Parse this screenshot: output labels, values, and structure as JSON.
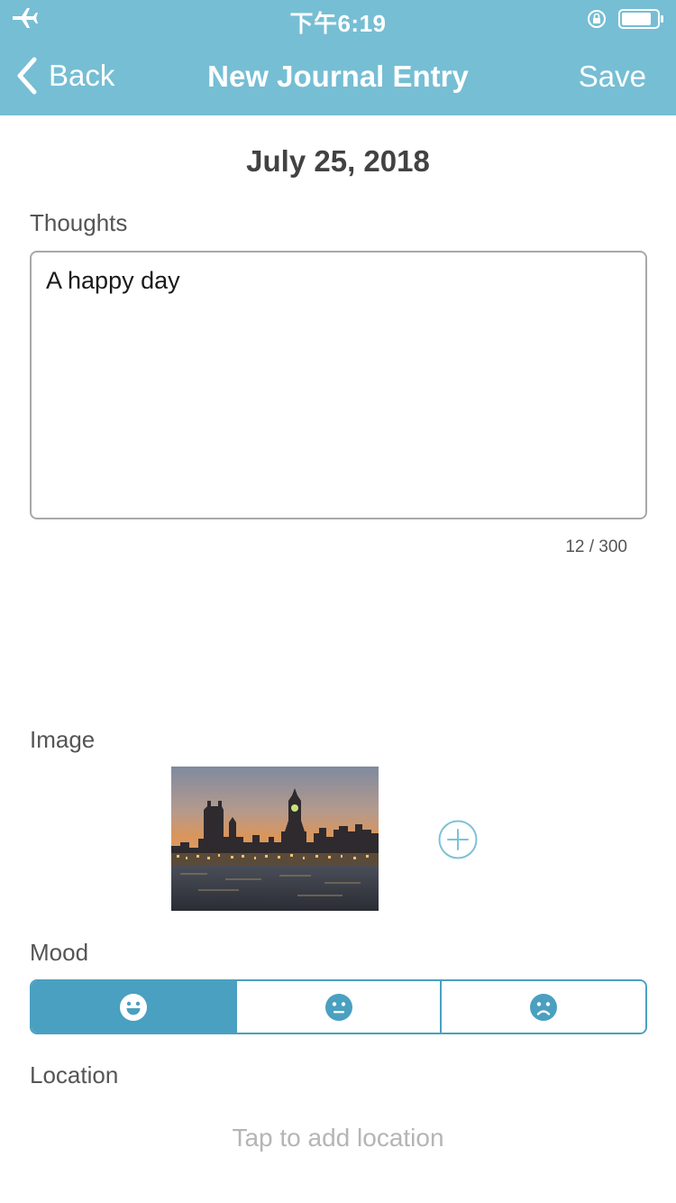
{
  "status_bar": {
    "time": "下午6:19",
    "icons": [
      "airplane-icon",
      "orientation-lock-icon",
      "battery-icon"
    ]
  },
  "nav": {
    "back_label": "Back",
    "title": "New Journal Entry",
    "save_label": "Save"
  },
  "entry": {
    "date": "July 25, 2018",
    "thoughts_label": "Thoughts",
    "thoughts_value": "A happy day",
    "char_counter": "12 / 300",
    "image_label": "Image",
    "mood_label": "Mood",
    "mood_options": [
      {
        "name": "happy-face-icon",
        "selected": true
      },
      {
        "name": "neutral-face-icon",
        "selected": false
      },
      {
        "name": "sad-face-icon",
        "selected": false
      }
    ],
    "location_label": "Location",
    "location_placeholder": "Tap to add location"
  },
  "colors": {
    "header": "#76bed4",
    "accent": "#4aa0c0",
    "muted_text": "#b5b5b5"
  }
}
